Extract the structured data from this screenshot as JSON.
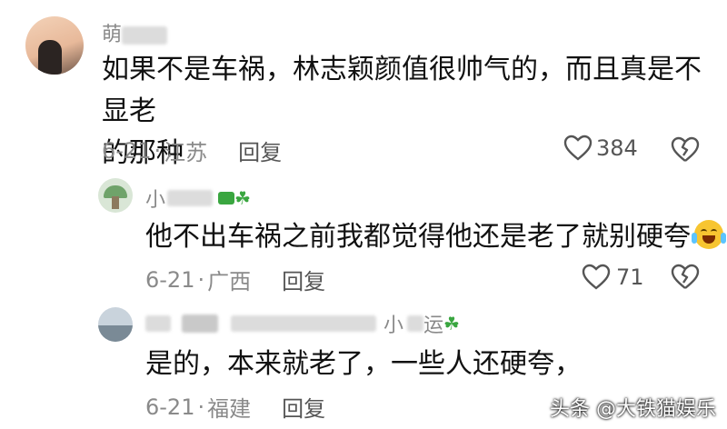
{
  "comments": [
    {
      "username": "萌",
      "text_line1": "如果不是车祸，林志颖颜值很帅气的，而且真是不显老",
      "text_line2": "的那种",
      "date": "6-21",
      "location": "江苏",
      "reply_label": "回复",
      "likes": "384"
    },
    {
      "username": "小",
      "text": "他不出车祸之前我都觉得他还是老了就别硬夸",
      "date": "6-21",
      "location": "广西",
      "reply_label": "回复",
      "likes": "71"
    },
    {
      "username_tail": "小",
      "username_tail2": "运",
      "text": "是的，本来就老了，一些人还硬夸，",
      "date": "6-21",
      "location": "福建",
      "reply_label": "回复"
    }
  ],
  "separator": "·",
  "watermark": "头条 @大铁猫娱乐",
  "colors": {
    "meta": "#8a8a8a",
    "clover": "#3aa640"
  },
  "icons": [
    "heart-outline-icon",
    "broken-heart-icon",
    "clover-icon",
    "laughing-tears-emoji"
  ]
}
